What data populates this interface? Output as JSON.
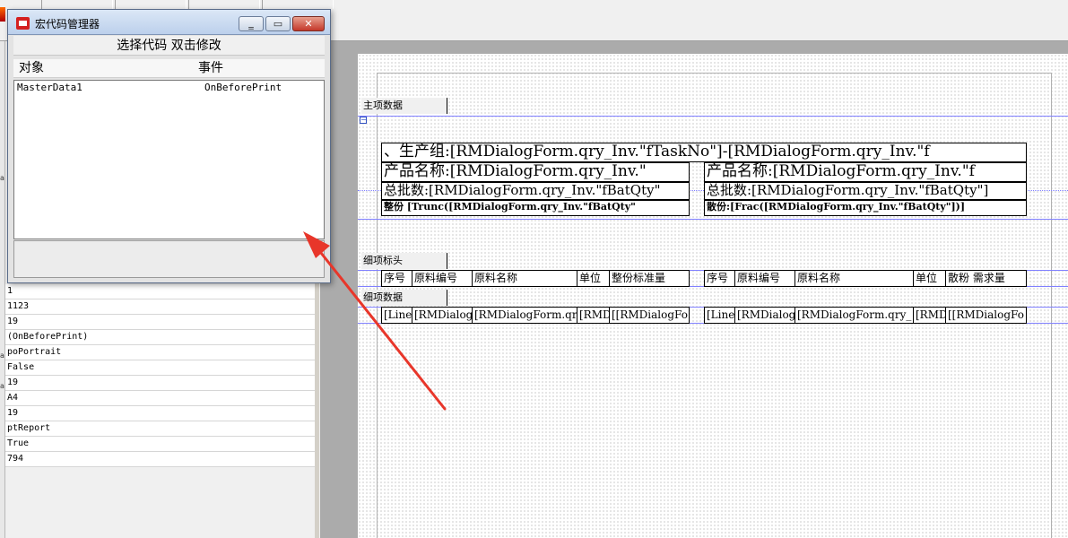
{
  "macro_window": {
    "title": "宏代码管理器",
    "header": "选择代码 双击修改",
    "col_object": "对象",
    "col_event": "事件",
    "items": [
      {
        "object": "MasterData1",
        "event": "OnBeforePrint"
      }
    ],
    "min_glyph": "‗",
    "max_glyph": "▭",
    "close_glyph": "✕"
  },
  "inspector": {
    "values": [
      "1",
      "1123",
      "19",
      "(OnBeforePrint)",
      "poPortrait",
      "False",
      "19",
      "A4",
      "19",
      "ptReport",
      "True",
      "794"
    ]
  },
  "bands": {
    "master_title": "主项数据",
    "detail_header_title": "细项标头",
    "detail_data_title": "细项数据",
    "collapse_glyph": "−"
  },
  "master": {
    "line1": "、生产组:[RMDialogForm.qry_Inv.\"fTaskNo\"]-[RMDialogForm.qry_Inv.\"f",
    "left_product": "产品名称:[RMDialogForm.qry_Inv.\"",
    "right_product": "产品名称:[RMDialogForm.qry_Inv.\"f",
    "left_batch": "总批数:[RMDialogForm.qry_Inv.\"fBatQty\"",
    "right_batch": "总批数:[RMDialogForm.qry_Inv.\"fBatQty\"]",
    "left_whole": "整份 [Trunc([RMDialogForm.qry_Inv.\"fBatQty\"",
    "right_loose": "散份:[Frac([RMDialogForm.qry_Inv.\"fBatQty\"])]"
  },
  "detail_header": {
    "left": [
      "序号",
      "原料编号",
      "原料名称",
      "单位",
      "整份标准量"
    ],
    "right": [
      "序号",
      "原料编号",
      "原料名称",
      "单位",
      "散粉 需求量"
    ]
  },
  "detail_data": {
    "left": [
      "[Line",
      "[RMDialog",
      "[RMDialogForm.qr",
      "[RMDi",
      "[[RMDialogFo"
    ],
    "right": [
      "[Line",
      "[RMDialog",
      "[RMDialogForm.qry_",
      "[RMDi",
      "[[RMDialogFo"
    ]
  },
  "colors": {
    "arrow": "#e8362a",
    "band_line": "#8080ff"
  }
}
